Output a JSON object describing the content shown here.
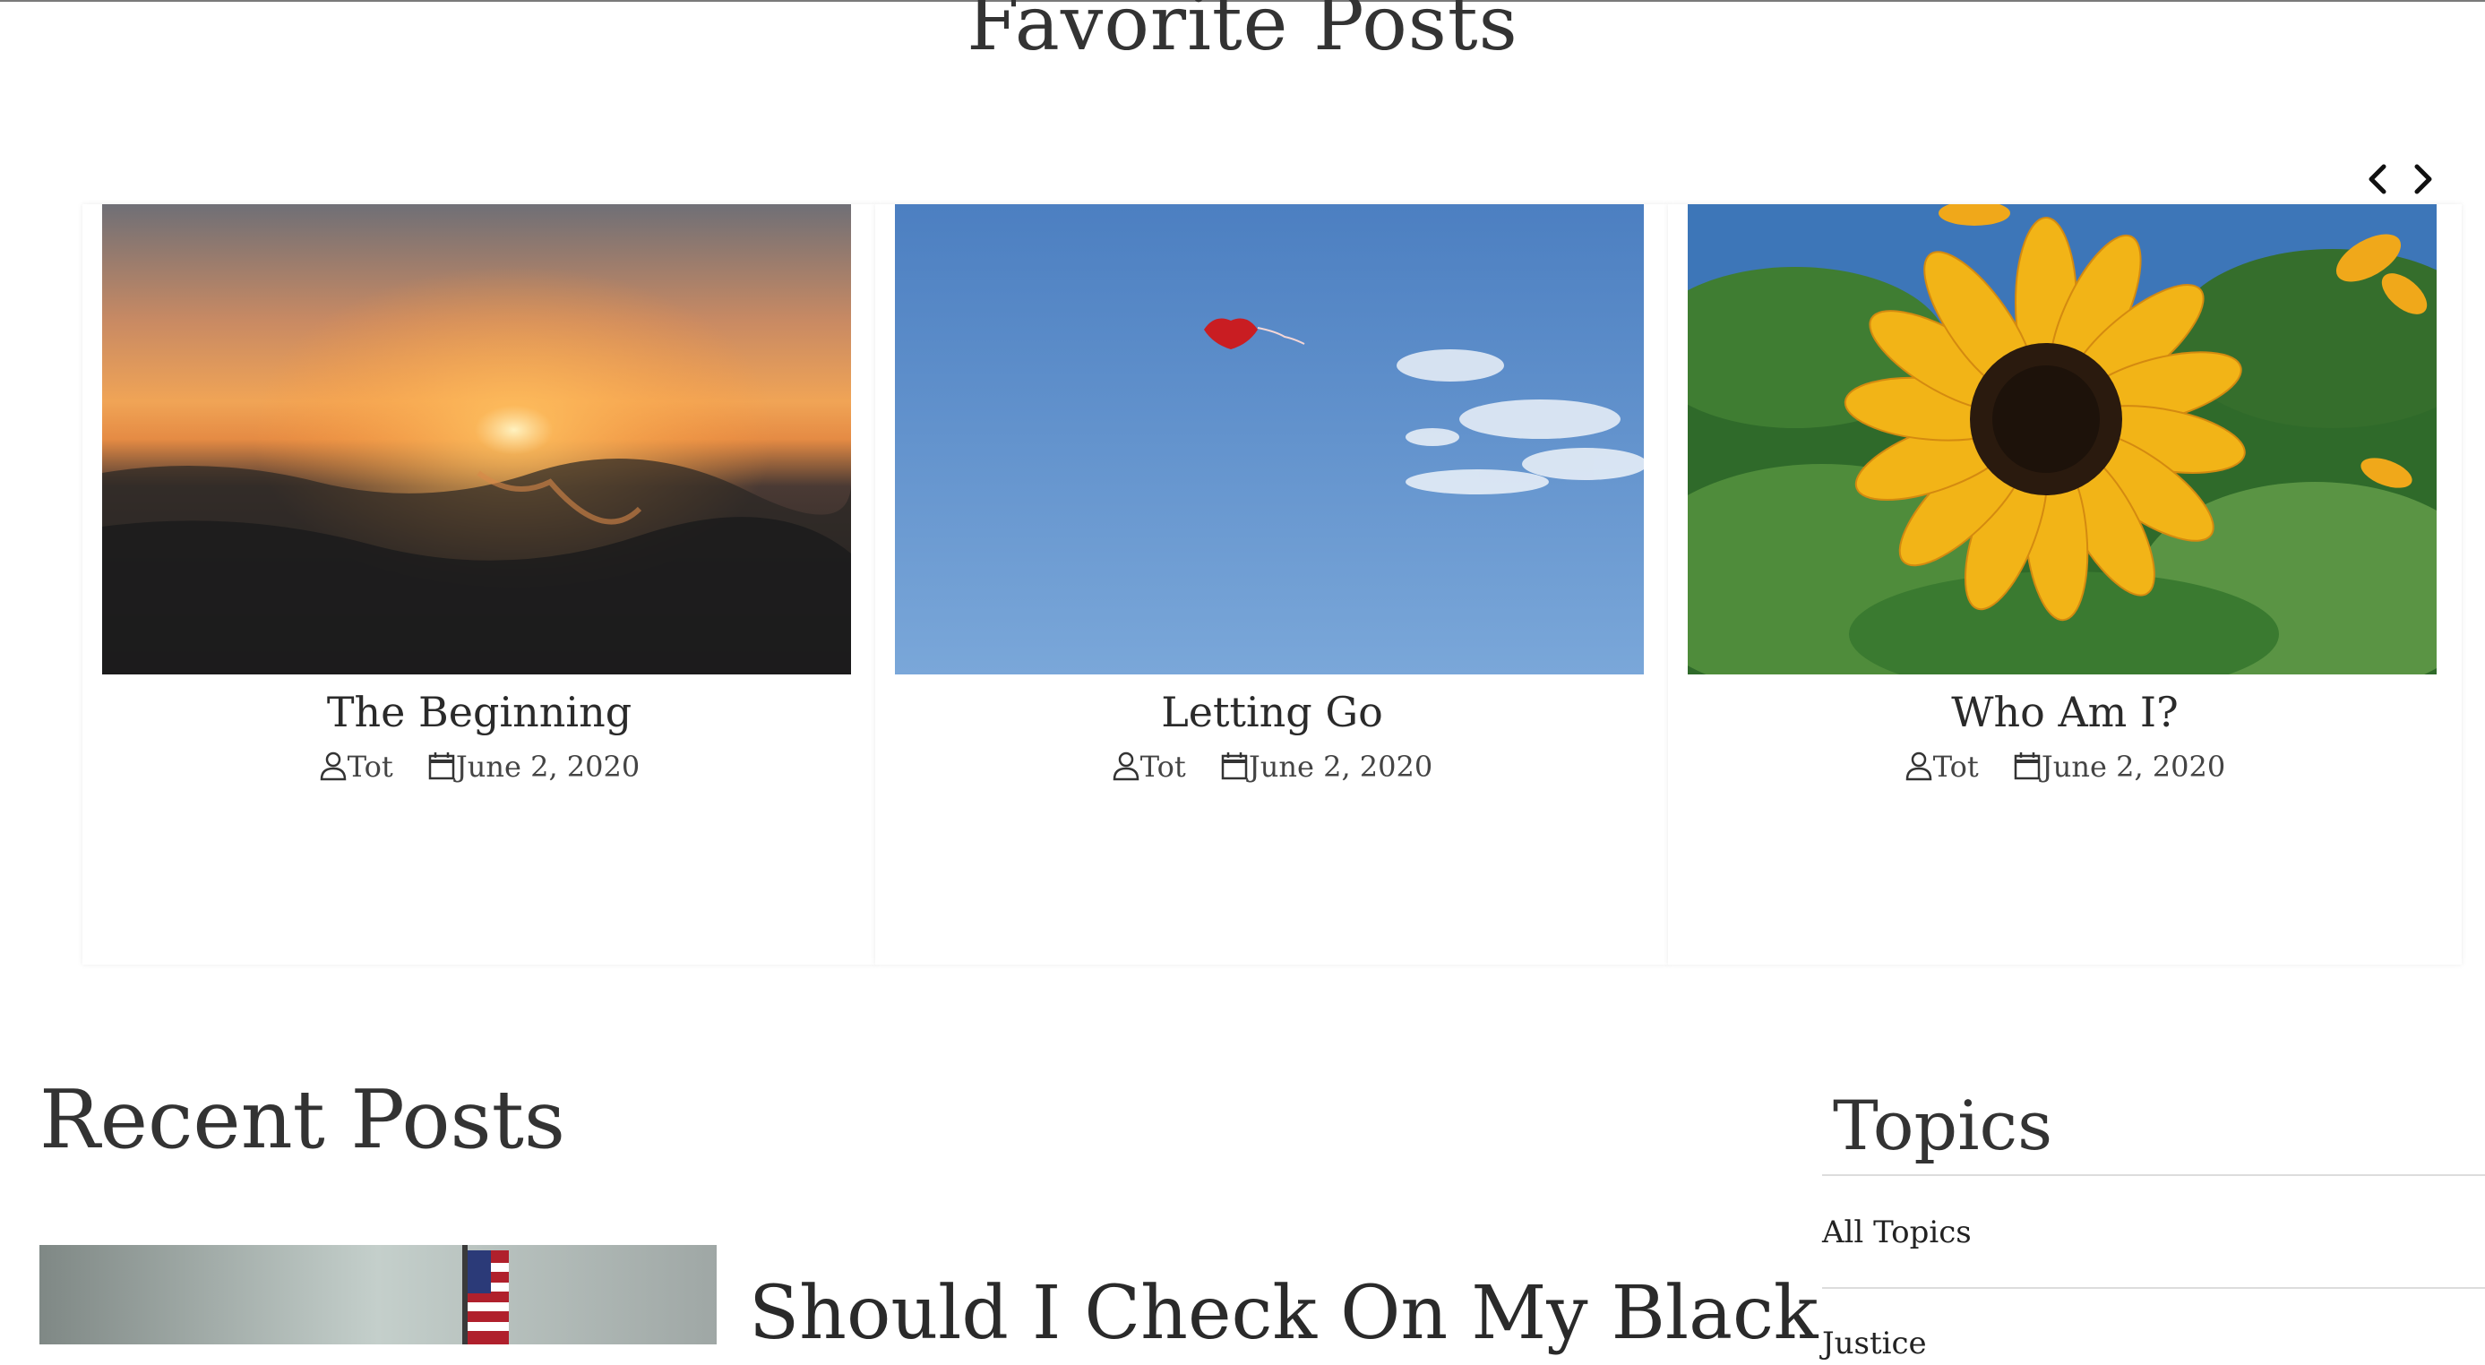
{
  "favorite_posts": {
    "title": "Favorite Posts",
    "prev_icon": "chevron-left-icon",
    "next_icon": "chevron-right-icon",
    "cards": [
      {
        "title": "The Beginning",
        "author": "Tot",
        "date": "June 2, 2020",
        "image": "ocean-sunset"
      },
      {
        "title": "Letting Go",
        "author": "Tot",
        "date": "June 2, 2020",
        "image": "red-balloon-sky"
      },
      {
        "title": "Who Am I?",
        "author": "Tot",
        "date": "June 2, 2020",
        "image": "sunflower"
      }
    ]
  },
  "recent_posts": {
    "title": "Recent Posts",
    "first_post_title": "Should I Check On My Black"
  },
  "topics": {
    "title": "Topics",
    "items": [
      "All Topics",
      "Justice"
    ]
  },
  "colors": {
    "text": "#2a2a2a",
    "divider": "#dcdcdc",
    "sky_blue": "#5f93cf",
    "sunflower_yellow": "#f2b417"
  }
}
